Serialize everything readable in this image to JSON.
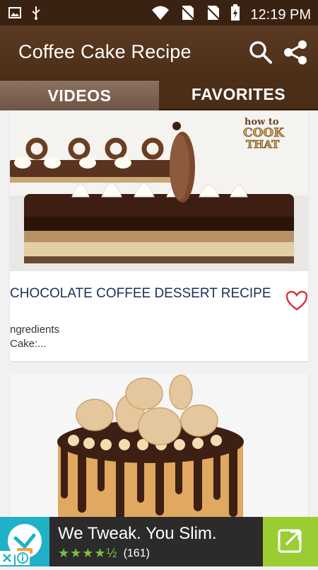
{
  "status_bar": {
    "time": "12:19 PM",
    "icons": [
      "image-icon",
      "usb-icon",
      "wifi-icon",
      "no-sim-icon",
      "no-sim-icon",
      "battery-charging-icon"
    ]
  },
  "app_bar": {
    "title": "Coffee Cake Recipe",
    "actions": [
      "search-icon",
      "share-icon"
    ]
  },
  "tabs": [
    {
      "label": "VIDEOS",
      "selected": false
    },
    {
      "label": "FAVORITES",
      "selected": true
    }
  ],
  "cards": [
    {
      "title": "CHOCOLATE COFFEE DESSERT RECIPE",
      "description": "ngredients\nCake:...",
      "favorite_icon": "heart-outline-icon",
      "watermark": "how to COOK THAT"
    },
    {
      "title": "",
      "description": ""
    }
  ],
  "ad": {
    "headline": "We Tweak. You Slim.",
    "rating_count": "(161)",
    "rating_value": 4.5,
    "colors": {
      "logo_bg": "#1fb1c7",
      "cta_bg": "#9acd32",
      "stars": "#79c143"
    }
  },
  "colors": {
    "app_bar": "#4b2d17",
    "title_text": "#1b2f57",
    "favorite_heart": "#d9303a"
  }
}
